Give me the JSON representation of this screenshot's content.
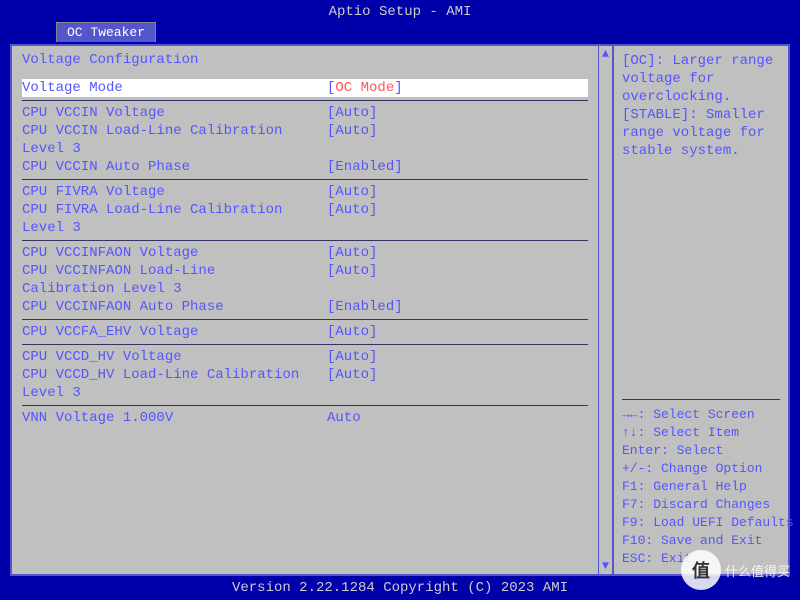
{
  "title": "Aptio Setup - AMI",
  "tab": "OC Tweaker",
  "section_title": "Voltage Configuration",
  "rows": [
    {
      "label": "Voltage Mode",
      "value": "OC Mode",
      "bracket": true,
      "selected": true
    },
    {
      "divider": true
    },
    {
      "label": "CPU VCCIN Voltage",
      "value": "Auto",
      "bracket": true
    },
    {
      "label": "CPU VCCIN Load-Line Calibration",
      "value": "Auto",
      "bracket": true
    },
    {
      "label": "Level 3",
      "value": ""
    },
    {
      "label": "CPU VCCIN Auto Phase",
      "value": "Enabled",
      "bracket": true
    },
    {
      "divider": true
    },
    {
      "label": "CPU FIVRA Voltage",
      "value": "Auto",
      "bracket": true
    },
    {
      "label": "CPU FIVRA Load-Line Calibration",
      "value": "Auto",
      "bracket": true
    },
    {
      "label": "Level 3",
      "value": ""
    },
    {
      "divider": true
    },
    {
      "label": "CPU VCCINFAON Voltage",
      "value": "Auto",
      "bracket": true
    },
    {
      "label": "CPU VCCINFAON Load-Line",
      "value": "Auto",
      "bracket": true
    },
    {
      "label": "Calibration  Level 3",
      "value": ""
    },
    {
      "label": "CPU VCCINFAON Auto Phase",
      "value": "Enabled",
      "bracket": true
    },
    {
      "divider": true
    },
    {
      "label": "CPU VCCFA_EHV Voltage",
      "value": "Auto",
      "bracket": true
    },
    {
      "divider": true
    },
    {
      "label": "CPU VCCD_HV Voltage",
      "value": "Auto",
      "bracket": true
    },
    {
      "label": "CPU VCCD_HV Load-Line Calibration",
      "value": "Auto",
      "bracket": true
    },
    {
      "label": "Level 3",
      "value": ""
    },
    {
      "divider": true
    },
    {
      "label": "VNN Voltage  1.000V",
      "value": "Auto",
      "bracket": false
    }
  ],
  "help_text": "[OC]: Larger range voltage for overclocking. [STABLE]: Smaller range voltage for stable system.",
  "keys": [
    "→←: Select Screen",
    "↑↓: Select Item",
    "Enter: Select",
    "+/-: Change Option",
    "F1: General Help",
    "F7: Discard Changes",
    "F9: Load UEFI Defaults",
    "F10: Save and Exit",
    "ESC: Exit"
  ],
  "footer": "Version 2.22.1284 Copyright (C) 2023 AMI",
  "watermark": {
    "badge": "值",
    "text": "什么值得买"
  }
}
